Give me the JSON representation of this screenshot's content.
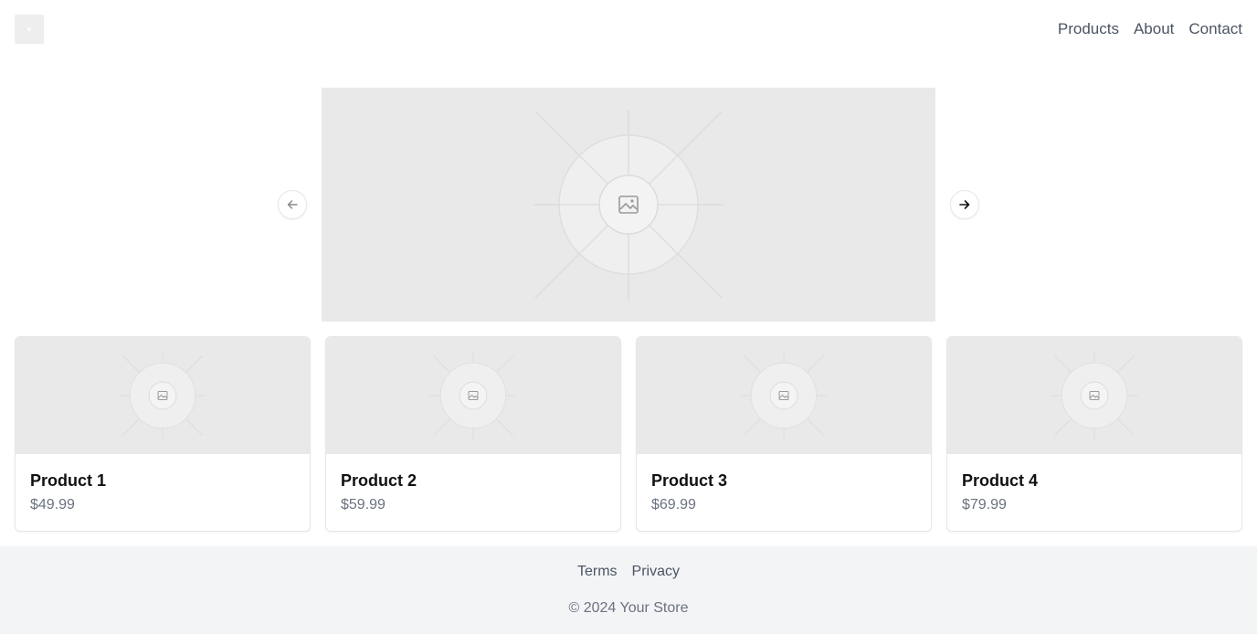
{
  "header": {
    "logo_icon": "logo-placeholder-icon",
    "nav": [
      {
        "label": "Products"
      },
      {
        "label": "About"
      },
      {
        "label": "Contact"
      }
    ]
  },
  "carousel": {
    "image_icon": "image-placeholder-icon",
    "prev_icon": "arrow-left-icon",
    "next_icon": "arrow-right-icon"
  },
  "products": [
    {
      "name": "Product 1",
      "price": "$49.99"
    },
    {
      "name": "Product 2",
      "price": "$59.99"
    },
    {
      "name": "Product 3",
      "price": "$69.99"
    },
    {
      "name": "Product 4",
      "price": "$79.99"
    }
  ],
  "footer": {
    "links": [
      {
        "label": "Terms"
      },
      {
        "label": "Privacy"
      }
    ],
    "copyright": "© 2024 Your Store"
  },
  "colors": {
    "placeholder_bg": "#e9e9e9",
    "footer_bg": "#f3f4f6",
    "text_muted": "#6b7280",
    "nav_text": "#4b5563"
  }
}
